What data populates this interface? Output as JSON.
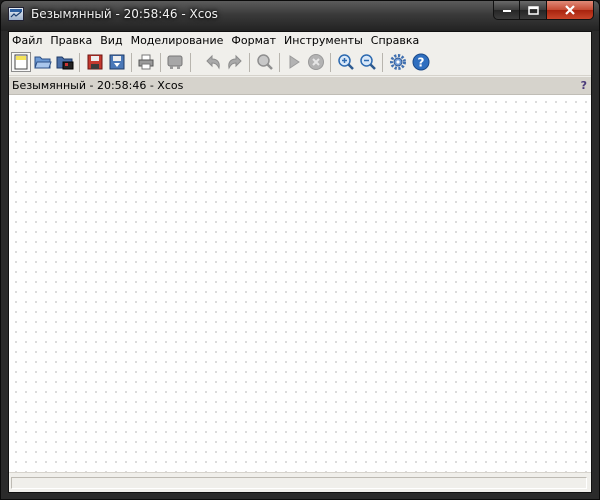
{
  "window": {
    "title": "Безымянный - 20:58:46 - Xcos"
  },
  "menu": [
    "Файл",
    "Правка",
    "Вид",
    "Моделирование",
    "Формат",
    "Инструменты",
    "Справка"
  ],
  "toolbar": {
    "buttons": [
      {
        "icon": "new-diagram-icon",
        "enabled": true
      },
      {
        "icon": "open-folder-icon",
        "enabled": true
      },
      {
        "icon": "open-in-scilab-icon",
        "enabled": true
      },
      {
        "icon": "save-icon",
        "enabled": true
      },
      {
        "icon": "save-as-icon",
        "enabled": true
      },
      {
        "icon": "print-icon",
        "enabled": true
      },
      {
        "icon": "palette-browser-icon",
        "enabled": false
      },
      {
        "icon": "undo-icon",
        "enabled": false
      },
      {
        "icon": "redo-icon",
        "enabled": false
      },
      {
        "icon": "fit-diagram-icon",
        "enabled": false
      },
      {
        "icon": "start-icon",
        "enabled": false
      },
      {
        "icon": "stop-icon",
        "enabled": false
      },
      {
        "icon": "zoom-in-icon",
        "enabled": true
      },
      {
        "icon": "zoom-out-icon",
        "enabled": true
      },
      {
        "icon": "setup-gear-icon",
        "enabled": true
      },
      {
        "icon": "help-icon",
        "enabled": true
      }
    ]
  },
  "infobar": {
    "text": "Безымянный - 20:58:46 - Xcos",
    "help": "?"
  },
  "status": {
    "text": ""
  },
  "colors": {
    "title_bar": "#3a3a3a",
    "chrome": "#f0efeb",
    "infobar": "#d6d3cc",
    "canvas": "#ffffff",
    "grid_dot": "#bcbcbc",
    "close_button": "#c74a33",
    "accent_blue": "#2d6ab0"
  }
}
